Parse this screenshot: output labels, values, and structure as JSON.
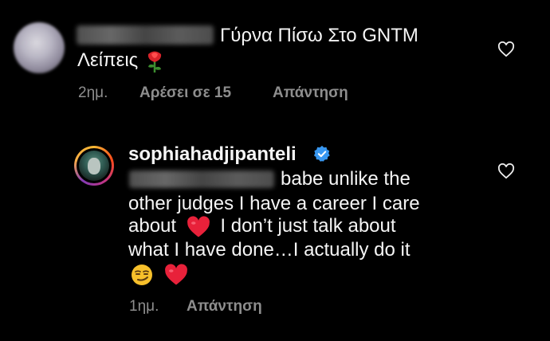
{
  "comment1": {
    "text_line1": "Γύρνα Πίσω Στο GNTM",
    "text_line2": "Λείπεις",
    "time": "2ημ.",
    "likes": "Αρέσει σε 15",
    "reply": "Απάντηση"
  },
  "comment2": {
    "username": "sophiahadjipanteli",
    "line1": "babe unlike the",
    "line2": "other judges I have a career I care",
    "line3_a": "about",
    "line3_b": "I don’t just talk about",
    "line4": "what I have done…I actually do it",
    "time": "1ημ.",
    "reply": "Απάντηση"
  },
  "icons": {
    "heart_outline": "heart-outline-icon",
    "verified": "verified-badge-icon",
    "rose": "rose-emoji",
    "red_heart": "red-heart-emoji",
    "smirk": "smirking-face-emoji"
  },
  "colors": {
    "background": "#000000",
    "text": "#f5f5f5",
    "secondary": "#8e8e8e",
    "verified": "#3897f0",
    "heart": "#e0245e"
  }
}
